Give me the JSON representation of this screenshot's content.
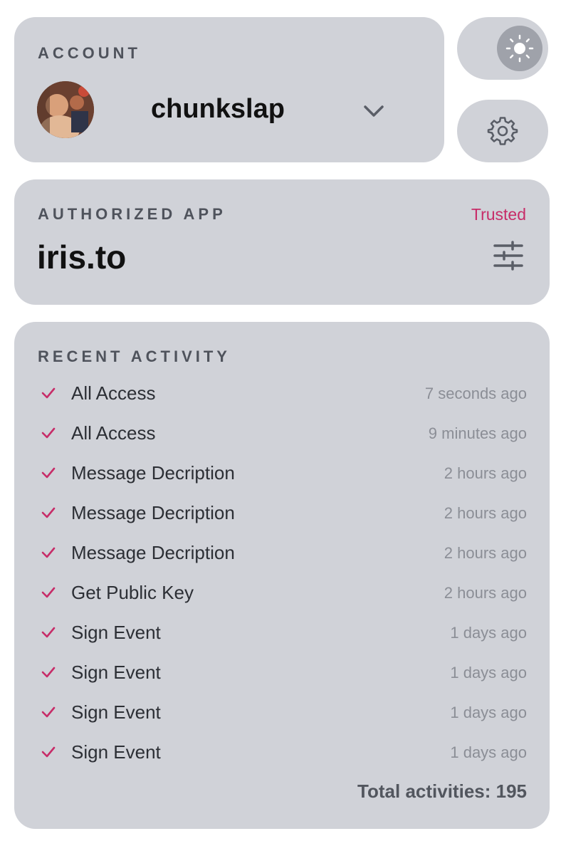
{
  "account": {
    "label": "ACCOUNT",
    "username": "chunkslap"
  },
  "authorized_app": {
    "label": "AUTHORIZED APP",
    "status": "Trusted",
    "name": "iris.to"
  },
  "recent_activity": {
    "label": "RECENT ACTIVITY",
    "items": [
      {
        "name": "All Access",
        "time": "7 seconds ago"
      },
      {
        "name": "All Access",
        "time": "9 minutes ago"
      },
      {
        "name": "Message Decription",
        "time": "2 hours ago"
      },
      {
        "name": "Message Decription",
        "time": "2 hours ago"
      },
      {
        "name": "Message Decription",
        "time": "2 hours ago"
      },
      {
        "name": "Get Public Key",
        "time": "2 hours ago"
      },
      {
        "name": "Sign Event",
        "time": "1 days ago"
      },
      {
        "name": "Sign Event",
        "time": "1 days ago"
      },
      {
        "name": "Sign Event",
        "time": "1 days ago"
      },
      {
        "name": "Sign Event",
        "time": "1 days ago"
      }
    ],
    "total": "Total activities: 195"
  },
  "icons": {
    "theme": "sun-icon",
    "settings": "gear-icon",
    "app_settings": "sliders-icon",
    "account_dropdown": "chevron-down-icon",
    "activity_status": "check-icon"
  },
  "colors": {
    "card_bg": "#d0d2d8",
    "accent": "#c72c68",
    "text_muted": "#8b8e96"
  }
}
